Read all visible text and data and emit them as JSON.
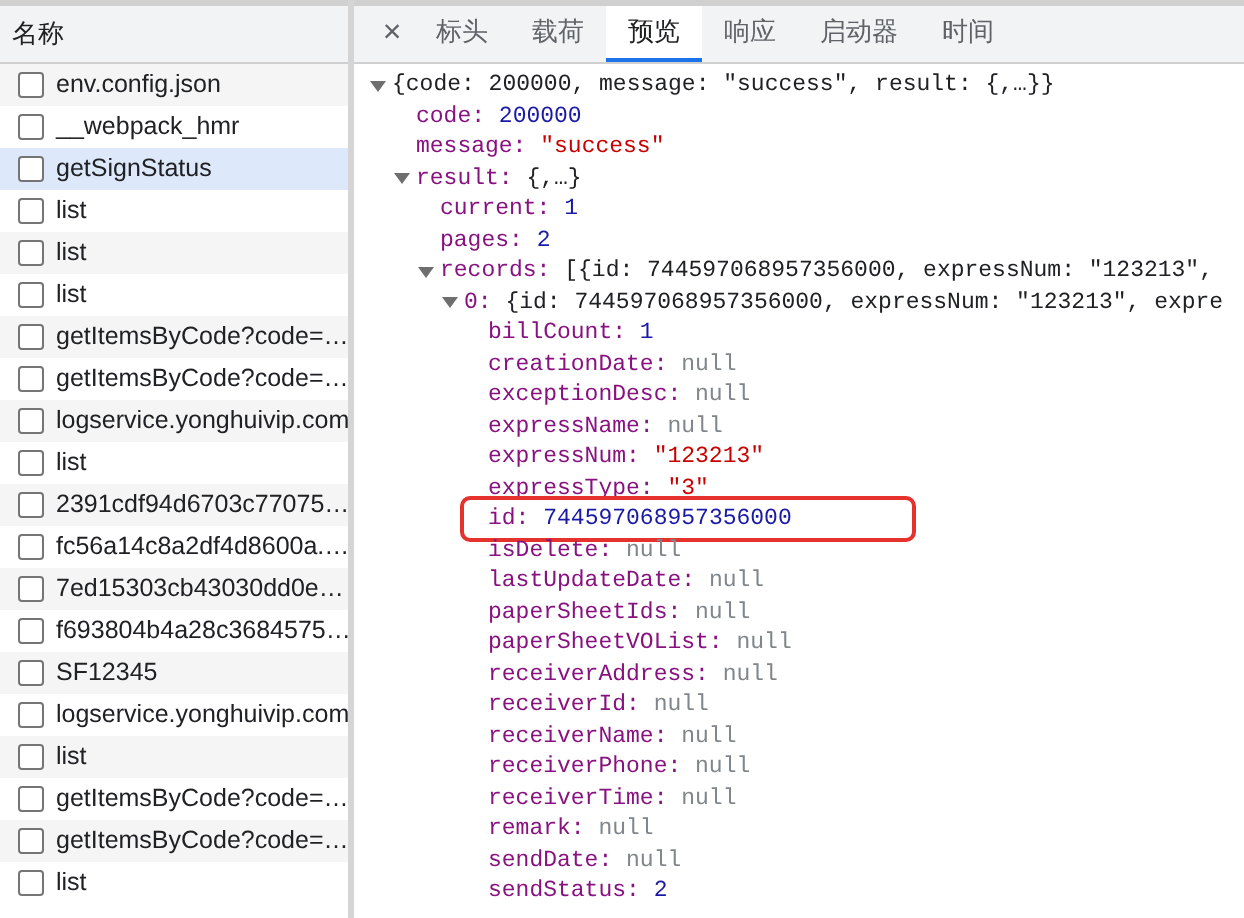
{
  "request_list": {
    "column_header": "名称",
    "rows": [
      {
        "name": "env.config.json",
        "selected": false,
        "checked": false
      },
      {
        "name": "__webpack_hmr",
        "selected": false,
        "checked": false
      },
      {
        "name": "getSignStatus",
        "selected": true,
        "checked": false
      },
      {
        "name": "list",
        "selected": false,
        "checked": false
      },
      {
        "name": "list",
        "selected": false,
        "checked": false
      },
      {
        "name": "list",
        "selected": false,
        "checked": false
      },
      {
        "name": "getItemsByCode?code=…",
        "selected": false,
        "checked": false
      },
      {
        "name": "getItemsByCode?code=…",
        "selected": false,
        "checked": false
      },
      {
        "name": "logservice.yonghuivip.com",
        "selected": false,
        "checked": false
      },
      {
        "name": "list",
        "selected": false,
        "checked": false
      },
      {
        "name": "2391cdf94d6703c77075…",
        "selected": false,
        "checked": false
      },
      {
        "name": "fc56a14c8a2df4d8600a.…",
        "selected": false,
        "checked": false
      },
      {
        "name": "7ed15303cb43030dd0e…",
        "selected": false,
        "checked": false
      },
      {
        "name": "f693804b4a28c3684575…",
        "selected": false,
        "checked": false
      },
      {
        "name": "SF12345",
        "selected": false,
        "checked": false
      },
      {
        "name": "logservice.yonghuivip.com",
        "selected": false,
        "checked": false
      },
      {
        "name": "list",
        "selected": false,
        "checked": false
      },
      {
        "name": "getItemsByCode?code=…",
        "selected": false,
        "checked": false
      },
      {
        "name": "getItemsByCode?code=…",
        "selected": false,
        "checked": false
      },
      {
        "name": "list",
        "selected": false,
        "checked": false
      }
    ]
  },
  "detail_tabs": {
    "close": "×",
    "tabs": [
      {
        "label": "标头",
        "selected": false
      },
      {
        "label": "载荷",
        "selected": false
      },
      {
        "label": "预览",
        "selected": true
      },
      {
        "label": "响应",
        "selected": false
      },
      {
        "label": "启动器",
        "selected": false
      },
      {
        "label": "时间",
        "selected": false
      }
    ]
  },
  "preview": {
    "tree": [
      {
        "kind": "object",
        "value": "{code: 200000, message: \"success\", result: {,…}}",
        "expanded": true,
        "children": [
          {
            "key": "code:",
            "kind": "number",
            "value": "200000"
          },
          {
            "key": "message:",
            "kind": "string",
            "value": "\"success\""
          },
          {
            "key": "result:",
            "kind": "object",
            "value": "{,…}",
            "expanded": true,
            "children": [
              {
                "key": "current:",
                "kind": "number",
                "value": "1"
              },
              {
                "key": "pages:",
                "kind": "number",
                "value": "2"
              },
              {
                "key": "records:",
                "kind": "object",
                "value": "[{id: 744597068957356000, expressNum: \"123213\",",
                "expanded": true,
                "children": [
                  {
                    "key": "0:",
                    "kind": "object",
                    "value": "{id: 744597068957356000, expressNum: \"123213\", expre",
                    "expanded": true,
                    "children": [
                      {
                        "key": "billCount:",
                        "kind": "number",
                        "value": "1"
                      },
                      {
                        "key": "creationDate:",
                        "kind": "null",
                        "value": "null"
                      },
                      {
                        "key": "exceptionDesc:",
                        "kind": "null",
                        "value": "null"
                      },
                      {
                        "key": "expressName:",
                        "kind": "null",
                        "value": "null"
                      },
                      {
                        "key": "expressNum:",
                        "kind": "string",
                        "value": "\"123213\""
                      },
                      {
                        "key": "expressType:",
                        "kind": "string",
                        "value": "\"3\""
                      },
                      {
                        "key": "id:",
                        "kind": "number",
                        "value": "744597068957356000",
                        "highlighted": true
                      },
                      {
                        "key": "isDelete:",
                        "kind": "null",
                        "value": "null"
                      },
                      {
                        "key": "lastUpdateDate:",
                        "kind": "null",
                        "value": "null"
                      },
                      {
                        "key": "paperSheetIds:",
                        "kind": "null",
                        "value": "null"
                      },
                      {
                        "key": "paperSheetVOList:",
                        "kind": "null",
                        "value": "null"
                      },
                      {
                        "key": "receiverAddress:",
                        "kind": "null",
                        "value": "null"
                      },
                      {
                        "key": "receiverId:",
                        "kind": "null",
                        "value": "null"
                      },
                      {
                        "key": "receiverName:",
                        "kind": "null",
                        "value": "null"
                      },
                      {
                        "key": "receiverPhone:",
                        "kind": "null",
                        "value": "null"
                      },
                      {
                        "key": "receiverTime:",
                        "kind": "null",
                        "value": "null"
                      },
                      {
                        "key": "remark:",
                        "kind": "null",
                        "value": "null"
                      },
                      {
                        "key": "sendDate:",
                        "kind": "null",
                        "value": "null"
                      },
                      {
                        "key": "sendStatus:",
                        "kind": "number",
                        "value": "2"
                      }
                    ]
                  }
                ]
              }
            ]
          }
        ]
      }
    ]
  }
}
